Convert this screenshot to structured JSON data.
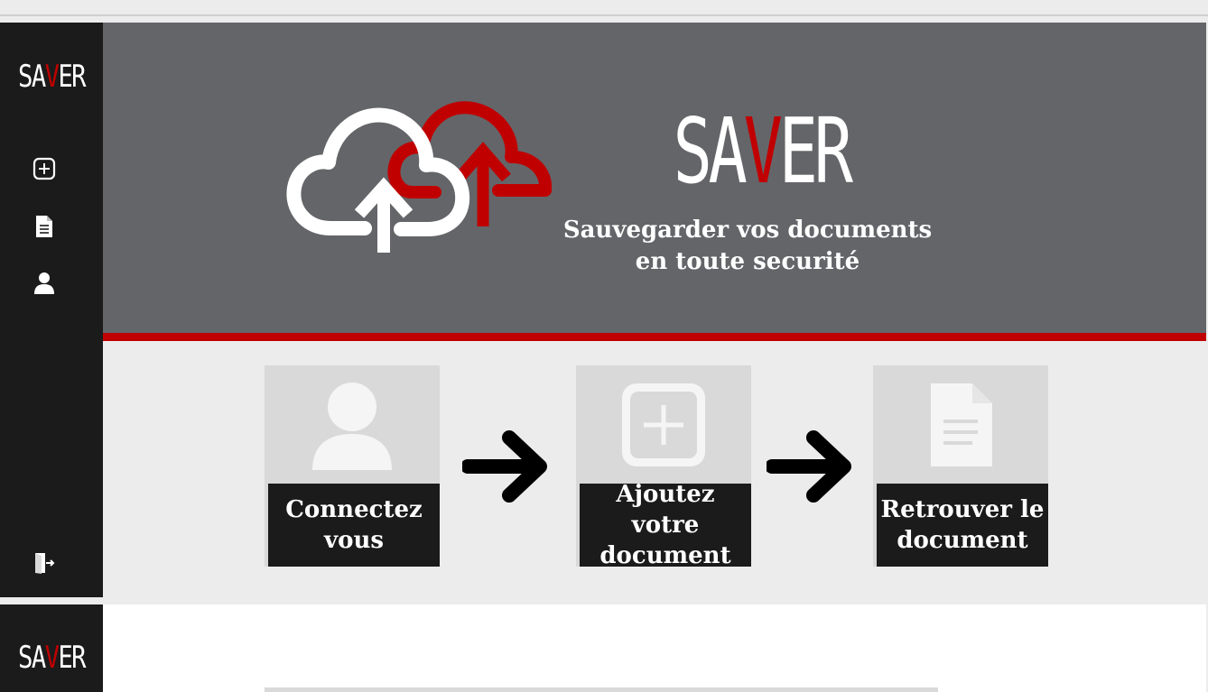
{
  "app": {
    "brand_prefix": "SA",
    "brand_accent": "V",
    "brand_suffix": "ER"
  },
  "sidebar": {
    "items": [
      {
        "icon": "add-square-icon"
      },
      {
        "icon": "document-icon"
      },
      {
        "icon": "user-icon"
      },
      {
        "icon": "logout-icon"
      }
    ]
  },
  "hero": {
    "tagline_line1": "Sauvegarder vos documents",
    "tagline_line2": "en toute securité"
  },
  "steps": [
    {
      "icon": "user-icon",
      "label_line1": "Connectez",
      "label_line2": "vous"
    },
    {
      "icon": "add-square-icon",
      "label_line1": "Ajoutez votre",
      "label_line2": "document"
    },
    {
      "icon": "document-icon",
      "label_line1": "Retrouver le",
      "label_line2": "document"
    }
  ],
  "colors": {
    "accent": "#c00000",
    "sidebar_bg": "#1b1b1b",
    "hero_bg": "#646569",
    "page_bg": "#ececec"
  }
}
